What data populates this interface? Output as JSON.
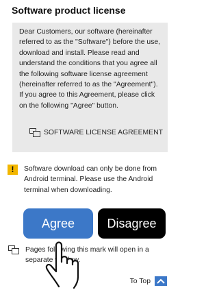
{
  "page": {
    "title": "Software product license",
    "license_text": "Dear Customers, our software (hereinafter referred to as the \"Software\") before the use, download and install. Please read and understand the conditions that you agree all the following software license agreement (hereinafter referred to as the \"Agreement\"). If you agree to this Agreement, please click on the following \"Agree\" button.",
    "license_link_label": "SOFTWARE LICENSE AGREEMENT",
    "warning_icon_glyph": "!",
    "warning_text": "Software download can only be done from Android terminal. Please use the Android terminal when downloading.",
    "agree_label": "Agree",
    "disagree_label": "Disagree",
    "note_text": "Pages following this mark will open in a separate window.",
    "to_top_label": "To Top"
  },
  "colors": {
    "agree_button": "#3c78c8",
    "disagree_button": "#000000",
    "warning_icon": "#f2b600",
    "license_box": "#e9e9e9"
  },
  "icons": {
    "license_link": "new-window-icon",
    "warning": "warning-icon",
    "note": "new-window-icon",
    "to_top": "chevron-up-icon",
    "pointer": "pointing-hand-icon"
  }
}
